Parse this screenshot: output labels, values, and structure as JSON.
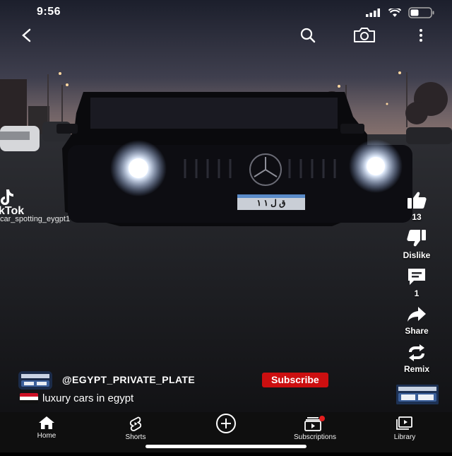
{
  "status_bar": {
    "time": "9:56"
  },
  "toolbar": {
    "back_icon": "chevron-left-icon",
    "search_icon": "search-icon",
    "camera_icon": "camera-icon",
    "more_icon": "more-vertical-icon"
  },
  "watermark": {
    "brand": "kTok",
    "username": "car_spotting_eygpt1"
  },
  "license_plate": "ق ل ١   ١",
  "actions": {
    "like_count": "13",
    "dislike_label": "Dislike",
    "comment_count": "1",
    "share_label": "Share",
    "remix_label": "Remix"
  },
  "channel": {
    "handle": "@EGYPT_PRIVATE_PLATE",
    "subscribe_label": "Subscribe"
  },
  "caption": "luxury cars in egypt",
  "nav": [
    {
      "label": "Home"
    },
    {
      "label": "Shorts"
    },
    {
      "label": ""
    },
    {
      "label": "Subscriptions"
    },
    {
      "label": "Library"
    }
  ],
  "colors": {
    "subscribe_red": "#cc0f10",
    "nav_bg": "#0f0f0f"
  }
}
